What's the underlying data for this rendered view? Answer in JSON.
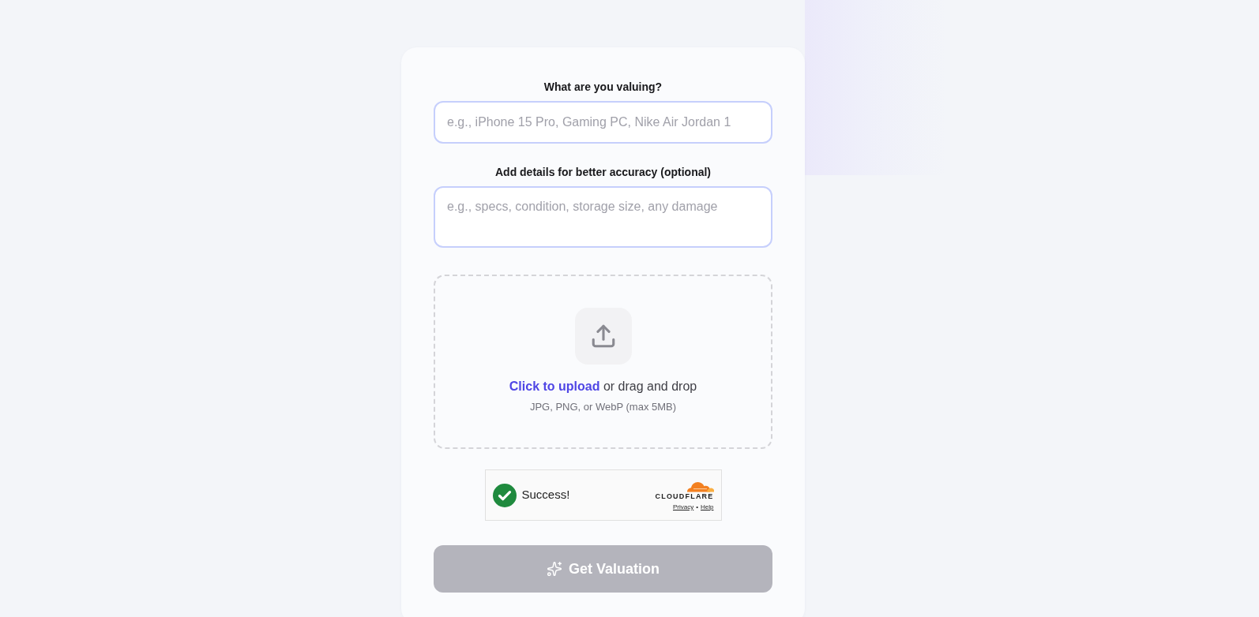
{
  "form": {
    "fields": [
      {
        "kind": "input",
        "label": "What are you valuing?",
        "placeholder": "e.g., iPhone 15 Pro, Gaming PC, Nike Air Jordan 1"
      },
      {
        "kind": "textarea",
        "label": "Add details for better accuracy (optional)",
        "placeholder": "e.g., specs, condition, storage size, any damage"
      }
    ],
    "upload": {
      "link": "Click to upload",
      "text": "or drag and drop",
      "hint": "JPG, PNG, or WebP (max 5MB)"
    },
    "captcha": {
      "success": true,
      "message": "Success!",
      "brand": "CLOUDFLARE",
      "links": [
        "Privacy",
        "Help"
      ],
      "separator": "•"
    },
    "submit": {
      "label": "Get Valuation",
      "disabled": true
    }
  }
}
